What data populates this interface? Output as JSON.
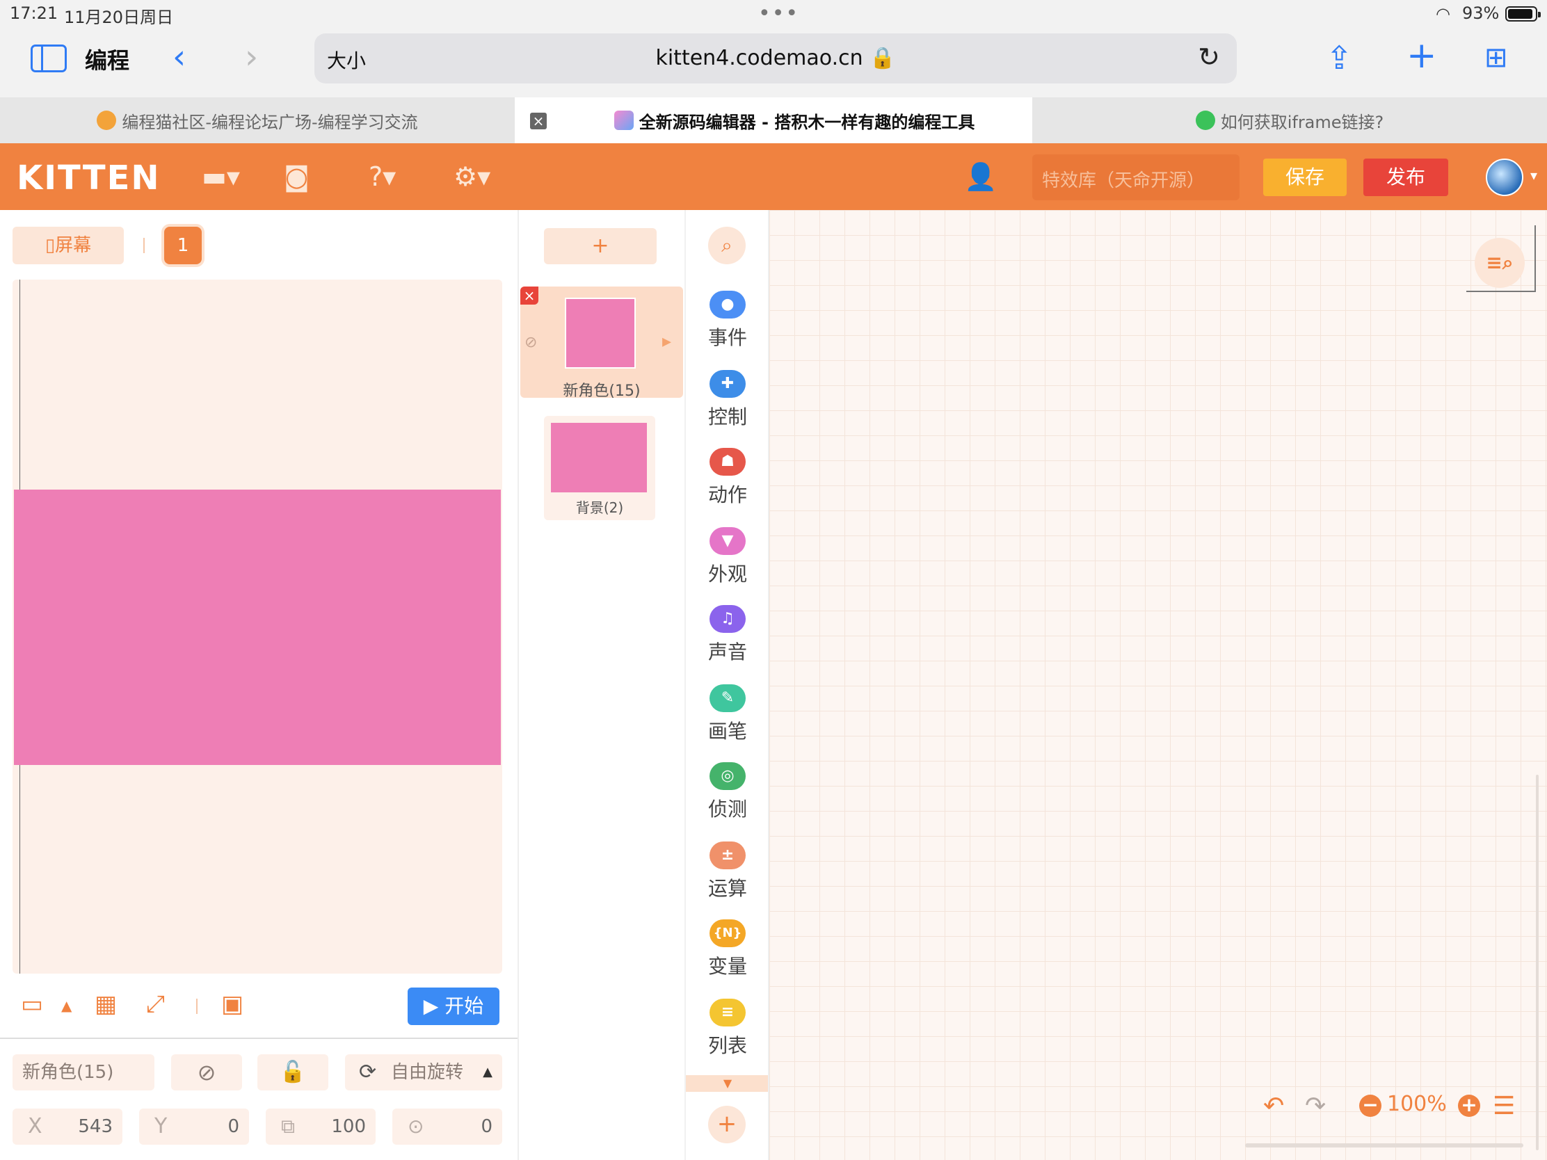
{
  "status": {
    "time": "17:21",
    "date": "11月20日周日",
    "battery": "93%"
  },
  "browser": {
    "edit_label": "编程",
    "address_aa": "大小",
    "url": "kitten4.codemao.cn 🔒",
    "tabs": [
      {
        "title": "编程猫社区-编程论坛广场-编程学习交流"
      },
      {
        "title": "全新源码编辑器 - 搭积木一样有趣的编程工具"
      },
      {
        "title": "如何获取iframe链接?"
      }
    ]
  },
  "kitten": {
    "logo": "KITTEN",
    "effects_placeholder": "特效库（天命开源）",
    "save": "保存",
    "publish": "发布",
    "colors": {
      "brand": "#f08240",
      "save": "#f9b02f",
      "publish": "#e8443a",
      "start": "#3b8bf5",
      "sprite": "#ee7eb5"
    }
  },
  "stage": {
    "screen_button": "屏幕",
    "screen_number": "1",
    "start_button": "开始",
    "sprite_name": "新角色(15)",
    "rotation_mode": "自由旋转",
    "x_label": "X",
    "x": "543",
    "y_label": "Y",
    "y": "0",
    "size": "100",
    "direction": "0"
  },
  "sprite_list": {
    "add": "+",
    "sprite_card_name": "新角色(15)",
    "background_card_name": "背景(2)"
  },
  "categories": [
    {
      "label": "事件",
      "icon": "toggle-icon",
      "color": "#4c8ff5"
    },
    {
      "label": "控制",
      "icon": "gamepad-icon",
      "color": "#3d8de8"
    },
    {
      "label": "动作",
      "icon": "ghost-icon",
      "color": "#e6574a"
    },
    {
      "label": "外观",
      "icon": "shirt-icon",
      "color": "#e575c8"
    },
    {
      "label": "声音",
      "icon": "music-icon",
      "color": "#8b63ec"
    },
    {
      "label": "画笔",
      "icon": "pen-icon",
      "color": "#3fc69e"
    },
    {
      "label": "侦测",
      "icon": "target-icon",
      "color": "#45b36b"
    },
    {
      "label": "运算",
      "icon": "math-icon",
      "color": "#f0916a"
    },
    {
      "label": "变量",
      "icon": "variable-icon",
      "color": "#f4a726",
      "glyph": "{N}"
    },
    {
      "label": "列表",
      "icon": "list-icon",
      "color": "#f4c531"
    }
  ],
  "workspace": {
    "zoom": "100%"
  }
}
